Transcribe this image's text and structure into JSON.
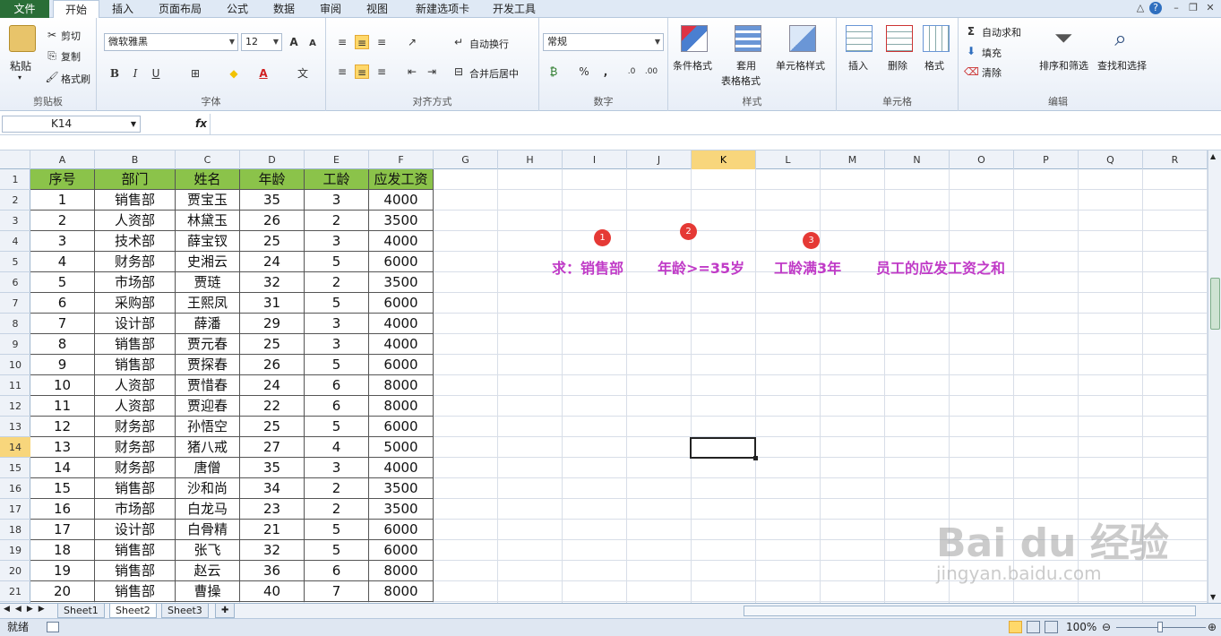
{
  "menu": {
    "file": "文件",
    "tabs": [
      "开始",
      "插入",
      "页面布局",
      "公式",
      "数据",
      "审阅",
      "视图",
      "新建选项卡",
      "开发工具"
    ]
  },
  "ribbon": {
    "clipboard": {
      "paste": "粘贴",
      "cut": "剪切",
      "copy": "复制",
      "format_painter": "格式刷",
      "label": "剪贴板"
    },
    "font": {
      "font_name": "微软雅黑",
      "font_size": "12",
      "bold": "B",
      "italic": "I",
      "underline": "U",
      "label": "字体"
    },
    "align": {
      "wrap": "自动换行",
      "merge": "合并后居中",
      "label": "对齐方式"
    },
    "number": {
      "format": "常规",
      "percent": "%",
      "comma": ",",
      "label": "数字"
    },
    "styles": {
      "conditional": "条件格式",
      "table_fmt_1": "套用",
      "table_fmt_2": "表格格式",
      "cell_style": "单元格样式",
      "label": "样式"
    },
    "cells": {
      "insert": "插入",
      "delete": "删除",
      "format": "格式",
      "label": "单元格"
    },
    "editing": {
      "autosum": "自动求和",
      "fill": "填充",
      "clear": "清除",
      "sort": "排序和筛选",
      "find": "查找和选择",
      "label": "编辑"
    }
  },
  "formula_bar": {
    "name_box": "K14",
    "fx": "fx",
    "value": ""
  },
  "columns": [
    "A",
    "B",
    "C",
    "D",
    "E",
    "F",
    "G",
    "H",
    "I",
    "J",
    "K",
    "L",
    "M",
    "N",
    "O",
    "P",
    "Q",
    "R"
  ],
  "selected_column": "K",
  "selected_row": "14",
  "rows": [
    "1",
    "2",
    "3",
    "4",
    "5",
    "6",
    "7",
    "8",
    "9",
    "10",
    "11",
    "12",
    "13",
    "14",
    "15",
    "16",
    "17",
    "18",
    "19",
    "20",
    "21"
  ],
  "table": {
    "headers": [
      "序号",
      "部门",
      "姓名",
      "年龄",
      "工龄",
      "应发工资"
    ],
    "data": [
      [
        "1",
        "销售部",
        "贾宝玉",
        "35",
        "3",
        "4000"
      ],
      [
        "2",
        "人资部",
        "林黛玉",
        "26",
        "2",
        "3500"
      ],
      [
        "3",
        "技术部",
        "薛宝钗",
        "25",
        "3",
        "4000"
      ],
      [
        "4",
        "财务部",
        "史湘云",
        "24",
        "5",
        "6000"
      ],
      [
        "5",
        "市场部",
        "贾琏",
        "32",
        "2",
        "3500"
      ],
      [
        "6",
        "采购部",
        "王熙凤",
        "31",
        "5",
        "6000"
      ],
      [
        "7",
        "设计部",
        "薛潘",
        "29",
        "3",
        "4000"
      ],
      [
        "8",
        "销售部",
        "贾元春",
        "25",
        "3",
        "4000"
      ],
      [
        "9",
        "销售部",
        "贾探春",
        "26",
        "5",
        "6000"
      ],
      [
        "10",
        "人资部",
        "贾惜春",
        "24",
        "6",
        "8000"
      ],
      [
        "11",
        "人资部",
        "贾迎春",
        "22",
        "6",
        "8000"
      ],
      [
        "12",
        "财务部",
        "孙悟空",
        "25",
        "5",
        "6000"
      ],
      [
        "13",
        "财务部",
        "猪八戒",
        "27",
        "4",
        "5000"
      ],
      [
        "14",
        "财务部",
        "唐僧",
        "35",
        "3",
        "4000"
      ],
      [
        "15",
        "销售部",
        "沙和尚",
        "34",
        "2",
        "3500"
      ],
      [
        "16",
        "市场部",
        "白龙马",
        "23",
        "2",
        "3500"
      ],
      [
        "17",
        "设计部",
        "白骨精",
        "21",
        "5",
        "6000"
      ],
      [
        "18",
        "销售部",
        "张飞",
        "32",
        "5",
        "6000"
      ],
      [
        "19",
        "销售部",
        "赵云",
        "36",
        "6",
        "8000"
      ],
      [
        "20",
        "销售部",
        "曹操",
        "40",
        "7",
        "8000"
      ]
    ]
  },
  "annotation": {
    "parts": [
      "求：销售部",
      "年龄>=35岁",
      "工龄满3年",
      "员工的应发工资之和"
    ],
    "badges": [
      "1",
      "2",
      "3"
    ]
  },
  "sheets": [
    "Sheet1",
    "Sheet2",
    "Sheet3"
  ],
  "active_sheet": "Sheet2",
  "status": {
    "ready": "就绪",
    "zoom": "100%"
  },
  "watermark": {
    "main": "Bai du 经验",
    "sub": "jingyan.baidu.com"
  },
  "colors": {
    "header_fill": "#8bc34a",
    "annotation": "#c03bc7",
    "badge": "#e53935",
    "file_tab": "#2a6e37"
  }
}
